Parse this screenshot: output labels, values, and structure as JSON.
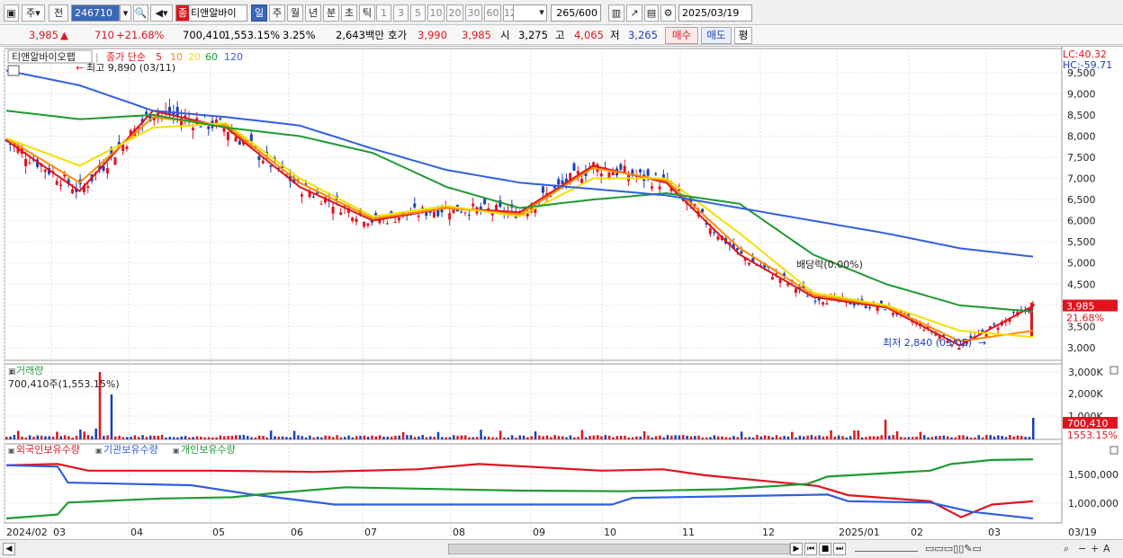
{
  "toolbar": {
    "market_type": "주",
    "scope": "전",
    "code": "246710",
    "stock_name": "티앤알바이",
    "stock_badge": "종",
    "periods": [
      "일",
      "주",
      "월",
      "년",
      "분",
      "초",
      "틱"
    ],
    "active_period": "일",
    "intervals": [
      "1",
      "3",
      "5",
      "10",
      "20",
      "30",
      "60",
      "120"
    ],
    "count": "265",
    "count_total": "/600",
    "date": "2025/03/19"
  },
  "quote": {
    "price": "3,985",
    "change_arrow": "▲",
    "change": "710",
    "change_pct": "+21.68%",
    "volume": "700,410",
    "volume_pct": "1,553.15%",
    "turnover": "3.25%",
    "amount": "2,643백만",
    "hoga_label": "호가",
    "ask": "3,990",
    "bid": "3,985",
    "open_label": "시",
    "open": "3,275",
    "high_label": "고",
    "high": "4,065",
    "low_label": "저",
    "low": "3,265",
    "buy_btn": "매수",
    "sell_btn": "매도",
    "eval_btn": "평"
  },
  "price_panel": {
    "stock_tag": "티앤알바이오팹",
    "legend_prefix": "종가 단순",
    "ma_periods": [
      "5",
      "10",
      "20",
      "60",
      "120"
    ],
    "ma_colors": [
      "#e0141e",
      "#ff8c00",
      "#f0e000",
      "#1e9a32",
      "#2f5fe0"
    ],
    "high_annotation": "최고 9,890 (03/11)",
    "low_annotation": "최저 2,840 (03/05)",
    "dividend_annotation": "배당락(0.00%)",
    "lc": "LC:40.32",
    "hc": "HC:-59.71",
    "current_price": "3,985",
    "current_pct": "21.68%",
    "y_ticks": [
      "9,500",
      "9,000",
      "8,500",
      "8,000",
      "7,500",
      "7,000",
      "6,500",
      "6,000",
      "5,500",
      "5,000",
      "4,500",
      "4,000",
      "3,500",
      "3,000"
    ]
  },
  "volume_panel": {
    "title": "거래량",
    "value_label": "700,410주(1,553.15%)",
    "y_ticks": [
      "3,000K",
      "2,000K",
      "1,000K"
    ],
    "current": "700,410",
    "current_pct": "1553.15%"
  },
  "holding_panel": {
    "legend": [
      "외국인보유수량",
      "기관보유수량",
      "개인보유수량"
    ],
    "legend_colors": [
      "#e0141e",
      "#2f5fe0",
      "#1e9a32"
    ],
    "y_ticks": [
      "1,500,000",
      "1,000,000"
    ]
  },
  "x_axis": {
    "labels": [
      "2024/02",
      "03",
      "04",
      "05",
      "06",
      "07",
      "08",
      "09",
      "10",
      "11",
      "12",
      "2025/01",
      "02",
      "03"
    ],
    "right_label": "03/19"
  },
  "chart_data": {
    "type": "line",
    "title": "",
    "xlabel": "",
    "ylabel": "",
    "ylim": [
      2700,
      9900
    ],
    "x": [
      "2024/02",
      "03",
      "04",
      "05",
      "06",
      "07",
      "08",
      "09",
      "10",
      "11",
      "12",
      "2025/01",
      "02",
      "03",
      "03/19"
    ],
    "series": [
      {
        "name": "5",
        "values": [
          7900,
          6700,
          8600,
          8200,
          6800,
          6000,
          6300,
          6200,
          7300,
          6900,
          5200,
          4200,
          3950,
          3050,
          3985
        ]
      },
      {
        "name": "10",
        "values": [
          7950,
          6900,
          8450,
          8250,
          6900,
          6050,
          6300,
          6150,
          7250,
          6950,
          5350,
          4250,
          3980,
          3150,
          3400
        ]
      },
      {
        "name": "20",
        "values": [
          7950,
          7300,
          8200,
          8300,
          7000,
          6100,
          6350,
          6100,
          7000,
          7000,
          5700,
          4300,
          4000,
          3400,
          3250
        ]
      },
      {
        "name": "60",
        "values": [
          8600,
          8400,
          8500,
          8200,
          8000,
          7600,
          6800,
          6300,
          6500,
          6650,
          6400,
          5200,
          4500,
          4000,
          3850
        ]
      },
      {
        "name": "120",
        "values": [
          9550,
          9200,
          8600,
          8450,
          8250,
          7700,
          7200,
          6900,
          6750,
          6600,
          6300,
          6000,
          5700,
          5350,
          5150
        ]
      }
    ]
  }
}
